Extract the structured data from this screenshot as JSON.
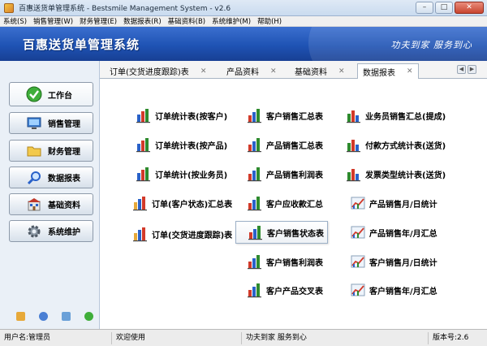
{
  "window": {
    "title": "百惠送货单管理系统 - Bestsmile Management System - v2.6",
    "buttons": {
      "minimize": "–",
      "maximize": "□",
      "close": "✕"
    }
  },
  "menu": [
    "系统(S)",
    "销售管理(W)",
    "财务管理(E)",
    "数据报表(R)",
    "基础资料(B)",
    "系统维护(M)",
    "帮助(H)"
  ],
  "banner": {
    "title": "百惠送货单管理系统",
    "slogan": "功夫到家 服务到心"
  },
  "sidebar": {
    "items": [
      {
        "label": "工作台",
        "icon": "check-circle-icon"
      },
      {
        "label": "销售管理",
        "icon": "monitor-icon"
      },
      {
        "label": "财务管理",
        "icon": "folder-icon"
      },
      {
        "label": "数据报表",
        "icon": "magnifier-icon"
      },
      {
        "label": "基础资料",
        "icon": "building-icon"
      },
      {
        "label": "系统维护",
        "icon": "gear-icon"
      }
    ]
  },
  "tabs": [
    {
      "label": "订单(交货进度跟踪)表"
    },
    {
      "label": "产品资料"
    },
    {
      "label": "基础资料"
    },
    {
      "label": "数据报表"
    }
  ],
  "tab_close": "✕",
  "tab_nav": {
    "prev": "◀",
    "next": "▶"
  },
  "reports": {
    "col1": [
      "订单统计表(按客户)",
      "订单统计表(按产品)",
      "订单统计(按业务员)",
      "订单(客户状态)汇总表",
      "订单(交货进度跟踪)表"
    ],
    "col2": [
      "客户销售汇总表",
      "产品销售汇总表",
      "产品销售利润表",
      "客户应收款汇总",
      "客户销售状态表",
      "客户销售利润表",
      "客户产品交叉表"
    ],
    "col3": [
      "业务员销售汇总(提成)",
      "付款方式统计表(送货)",
      "发票类型统计表(送货)",
      "产品销售月/日统计",
      "产品销售年/月汇总",
      "客户销售月/日统计",
      "客户销售年/月汇总"
    ]
  },
  "status": {
    "user": "用户名:管理员",
    "welcome": "欢迎使用",
    "slogan": "功夫到家 服务到心",
    "version": "版本号:2.6"
  },
  "colors": {
    "banner": "#1f53b4",
    "accent_bar": "#2e8b2e",
    "icon_bar_red": "#d23a2a",
    "icon_bar_blue": "#2a62c9"
  }
}
